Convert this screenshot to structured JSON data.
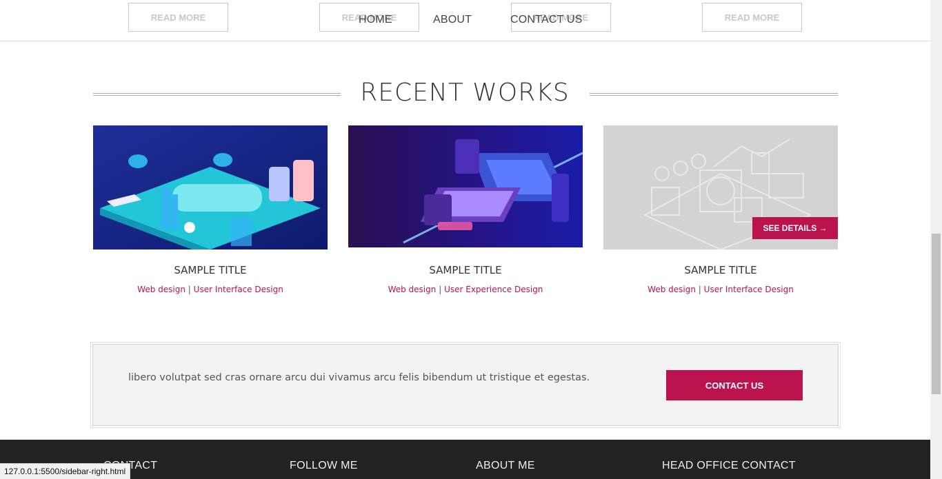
{
  "header": {
    "read_more_label": "READ MORE",
    "nav": {
      "home": "HOME",
      "about": "ABOUT",
      "contact": "CONTACT US"
    }
  },
  "recent_works": {
    "title": "RECENT WORKS",
    "cards": [
      {
        "title": "SAMPLE TITLE",
        "tag1": "Web design",
        "separator": "|",
        "tag2": "User Interface Design"
      },
      {
        "title": "SAMPLE TITLE",
        "tag1": "Web design",
        "separator": "|",
        "tag2": "User Experience Design"
      },
      {
        "title": "SAMPLE TITLE",
        "tag1": "Web design",
        "separator": "|",
        "tag2": "User Interface Design",
        "button": "SEE DETAILS →"
      }
    ]
  },
  "cta": {
    "text": "libero volutpat sed cras ornare arcu dui vivamus arcu felis bibendum ut tristique et egestas.",
    "button": "CONTACT US"
  },
  "footer": {
    "headings": [
      "CONTACT",
      "FOLLOW ME",
      "ABOUT ME",
      "HEAD OFFICE CONTACT"
    ]
  },
  "status_bar": {
    "url": "127.0.0.1:5500/sidebar-right.html"
  },
  "colors": {
    "accent": "#bb134f",
    "footer_bg": "#222222",
    "cta_bg": "#f2f2f2"
  }
}
